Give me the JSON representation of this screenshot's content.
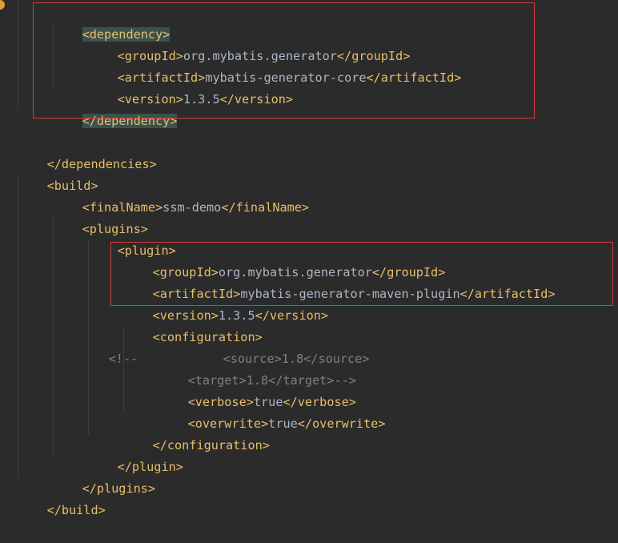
{
  "code": {
    "lines": [
      [
        "<dependency>"
      ],
      [
        "<groupId>",
        "org.mybatis.generator",
        "</groupId>"
      ],
      [
        "<artifactId>",
        "mybatis-generator-core",
        "</artifactId>"
      ],
      [
        "<version>",
        "1.3.5",
        "</version>"
      ],
      [
        "</dependency>"
      ],
      [],
      [
        "</dependencies>"
      ],
      [
        "<build>"
      ],
      [
        "<finalName>",
        "ssm-demo",
        "</finalName>"
      ],
      [
        "<plugins>"
      ],
      [
        "<plugin>"
      ],
      [
        "<groupId>",
        "org.mybatis.generator",
        "</groupId>"
      ],
      [
        "<artifactId>",
        "mybatis-generator-maven-plugin",
        "</artifactId>"
      ],
      [
        "<version>",
        "1.3.5",
        "</version>"
      ],
      [
        "<configuration>"
      ],
      [
        "<!--",
        "<source>1.8</source>"
      ],
      [
        "<target>1.8</target>-->"
      ],
      [
        "<verbose>",
        "true",
        "</verbose>"
      ],
      [
        "<overwrite>",
        "true",
        "</overwrite>"
      ],
      [
        "</configuration>"
      ],
      [
        "</plugin>"
      ],
      [
        "</plugins>"
      ],
      [
        "</build>"
      ]
    ]
  },
  "colors": {
    "background": "#2b2b2b",
    "tag": "#e8bf6a",
    "text": "#a9b7c6",
    "comment": "#808080",
    "matched_tag_highlight": "#3b514d",
    "annotation_box": "#d43b3b"
  },
  "icons": {
    "gutter": "intention-bulb-icon"
  }
}
